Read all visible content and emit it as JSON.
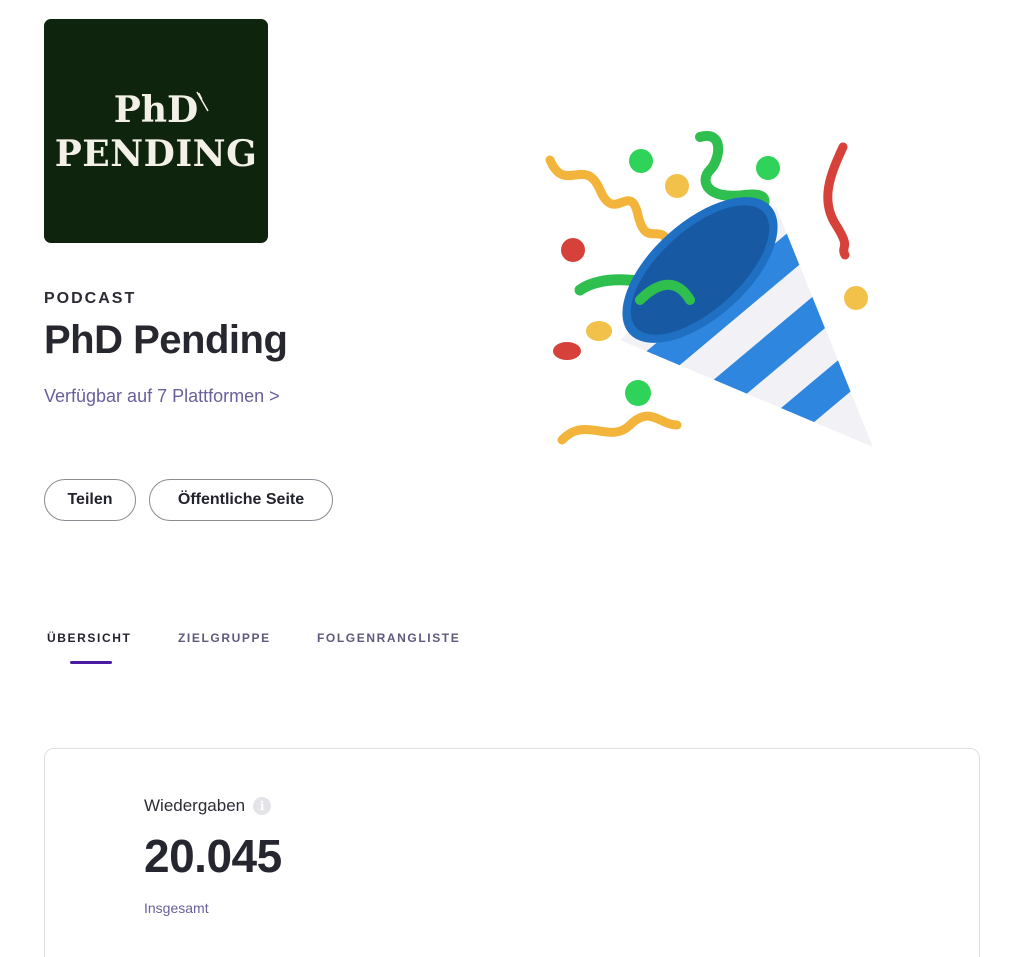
{
  "podcast": {
    "cover": {
      "line1": "PhD",
      "line2": "PENDING",
      "background": "#0f240c"
    },
    "type_label": "PODCAST",
    "title": "PhD Pending",
    "platforms_link": "Verfügbar auf 7 Plattformen >"
  },
  "actions": {
    "share_label": "Teilen",
    "public_page_label": "Öffentliche Seite"
  },
  "celebration": {
    "icon": "party-popper-icon"
  },
  "tabs": [
    {
      "label": "ÜBERSICHT",
      "active": true
    },
    {
      "label": "ZIELGRUPPE",
      "active": false
    },
    {
      "label": "FOLGENRANGLISTE",
      "active": false
    }
  ],
  "stats": {
    "label": "Wiedergaben",
    "info_icon": "info-icon",
    "value": "20.045",
    "sublabel": "Insgesamt"
  },
  "colors": {
    "accent": "#4a1ca2",
    "link": "#6a5f9c"
  }
}
